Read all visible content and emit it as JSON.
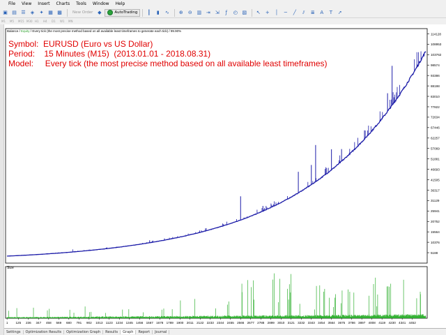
{
  "menu": [
    "File",
    "View",
    "Insert",
    "Charts",
    "Tools",
    "Window",
    "Help"
  ],
  "toolbar": {
    "new_order": "New Order",
    "auto_trading": "AutoTrading"
  },
  "timeframes": [
    "M1",
    "M5",
    "M15",
    "M30",
    "H1",
    "H4",
    "D1",
    "W1",
    "MN"
  ],
  "legend": {
    "balance": "Balance",
    "equity": "Equity",
    "text": "Every tick (the most precise method based on all available least timeframes to generate each tick)",
    "quality": "99.90%"
  },
  "overlay": {
    "symbol": "Symbol:  EURUSD (Euro vs US Dollar)",
    "period": "Period:    15 Minutes (M15)  (2013.01.01 - 2018.08.31)",
    "model": "Model:     Every tick (the most precise method based on all available least timeframes)"
  },
  "size_label": "Size",
  "bottom_tabs": [
    "Settings",
    "Optimization Results",
    "Optimization Graph",
    "Results",
    "Graph",
    "Report",
    "Journal"
  ],
  "active_tab": "Graph",
  "colors": {
    "balance": "#1b1ba8",
    "equity": "#2ea02e",
    "size_bars": "#30b030",
    "overlay_text": "#e00000"
  },
  "chart_data": {
    "type": "line",
    "ylabels": [
      "114128",
      "108953",
      "103762",
      "98574",
      "93386",
      "88198",
      "83010",
      "77822",
      "72634",
      "67446",
      "62257",
      "57069",
      "51881",
      "46693",
      "41505",
      "36317",
      "31129",
      "25941",
      "20752",
      "15564",
      "10376",
      "5188"
    ],
    "xlabels": [
      "1",
      "125",
      "236",
      "347",
      "458",
      "569",
      "680",
      "791",
      "902",
      "1013",
      "1123",
      "1234",
      "1345",
      "1456",
      "1567",
      "1678",
      "1789",
      "1900",
      "2011",
      "2122",
      "2233",
      "2344",
      "2455",
      "2566",
      "2677",
      "2788",
      "2899",
      "3010",
      "3121",
      "3232",
      "3343",
      "3454",
      "3564",
      "3675",
      "3786",
      "3897",
      "4008",
      "4119",
      "4230",
      "4341",
      "4452"
    ],
    "trades_total": 4600,
    "ylim": [
      0,
      116722
    ],
    "balance_start": 3500,
    "balance_end": 105500,
    "size_max": 1
  }
}
